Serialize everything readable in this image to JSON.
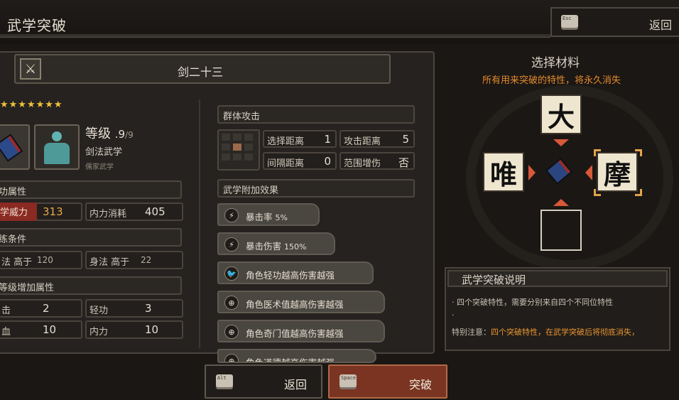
{
  "header": {
    "title": "武学突破",
    "esc_key": "Esc",
    "back_label": "返回"
  },
  "skill": {
    "name": "剑二十三",
    "stars": "★★★★★★★",
    "level_label": "等级",
    "level_current": ".9",
    "level_max": "/9",
    "style": "剑法武学",
    "school": "儒家武学"
  },
  "sections": {
    "attributes": "功属性",
    "conditions": "练条件",
    "level_bonus": "等级增加属性"
  },
  "attributes": {
    "power_label": "学威力",
    "power_value": "313",
    "mana_label": "内力消耗",
    "mana_value": "405"
  },
  "conditions": {
    "c1_label": "法 高于",
    "c1_value": "120",
    "c2_label": "身法 高于",
    "c2_value": "22"
  },
  "bonus": {
    "b1_label": "击",
    "b1_value": "2",
    "b2_label": "轻功",
    "b2_value": "3",
    "b3_label": "血",
    "b3_value": "10",
    "b4_label": "内力",
    "b4_value": "10"
  },
  "attack": {
    "type": "群体攻击",
    "select_range_label": "选择距离",
    "select_range_value": "1",
    "attack_range_label": "攻击距离",
    "attack_range_value": "5",
    "interval_label": "间隔距离",
    "interval_value": "0",
    "aoe_label": "范围增伤",
    "aoe_value": "否"
  },
  "effects": {
    "header": "武学附加效果",
    "items": [
      {
        "icon": "⚡",
        "name": "暴击率",
        "value": "5%"
      },
      {
        "icon": "⚡",
        "name": "暴击伤害",
        "value": "150%"
      },
      {
        "icon": "🐦",
        "name": "角色轻功越高伤害越强",
        "value": ""
      },
      {
        "icon": "⊕",
        "name": "角色医术值越高伤害越强",
        "value": ""
      },
      {
        "icon": "⊕",
        "name": "角色奇门值越高伤害越强",
        "value": ""
      },
      {
        "icon": "⊕",
        "name": "角色道德越高伤害越强",
        "value": ""
      }
    ]
  },
  "materials": {
    "title": "选择材料",
    "warning": "所有用来突破的特性，将永久消失",
    "top": "大",
    "left": "唯",
    "right": "摩"
  },
  "explain": {
    "title": "武学突破说明",
    "line1": "· 四个突破特性，需要分别来自四个不同位特性",
    "line2": "·",
    "line3_prefix": "特别注意：",
    "line3_highlight": "四个突破特性，在武学突破后将彻底消失，"
  },
  "buttons": {
    "back_key": "Alt",
    "back_label": "返回",
    "break_key": "Space",
    "break_label": "突破"
  },
  "colors": {
    "accent_orange": "#e58a2c",
    "power_red": "#8a2a22",
    "break_button": "#7a3421",
    "star_gold": "#f0c23a"
  }
}
